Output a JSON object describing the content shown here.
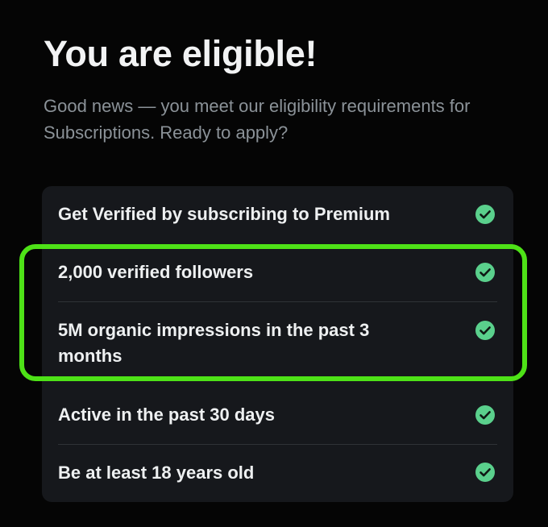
{
  "header": {
    "title": "You are eligible!",
    "subtitle": "Good news — you meet our eligibility requirements for Subscriptions. Ready to apply?"
  },
  "requirements": [
    {
      "label": "Get Verified by subscribing to Premium",
      "status_icon": "check-circle-icon",
      "met": true
    },
    {
      "label": "2,000 verified followers",
      "status_icon": "check-circle-icon",
      "met": true
    },
    {
      "label": "5M organic impressions in the past 3 months",
      "status_icon": "check-circle-icon",
      "met": true
    },
    {
      "label": "Active in the past 30 days",
      "status_icon": "check-circle-icon",
      "met": true
    },
    {
      "label": "Be at least 18 years old",
      "status_icon": "check-circle-icon",
      "met": true
    }
  ],
  "colors": {
    "background": "#050505",
    "card": "#16181c",
    "check": "#5ad08c",
    "highlight": "#4ee217",
    "subtitle": "#8b9298"
  }
}
